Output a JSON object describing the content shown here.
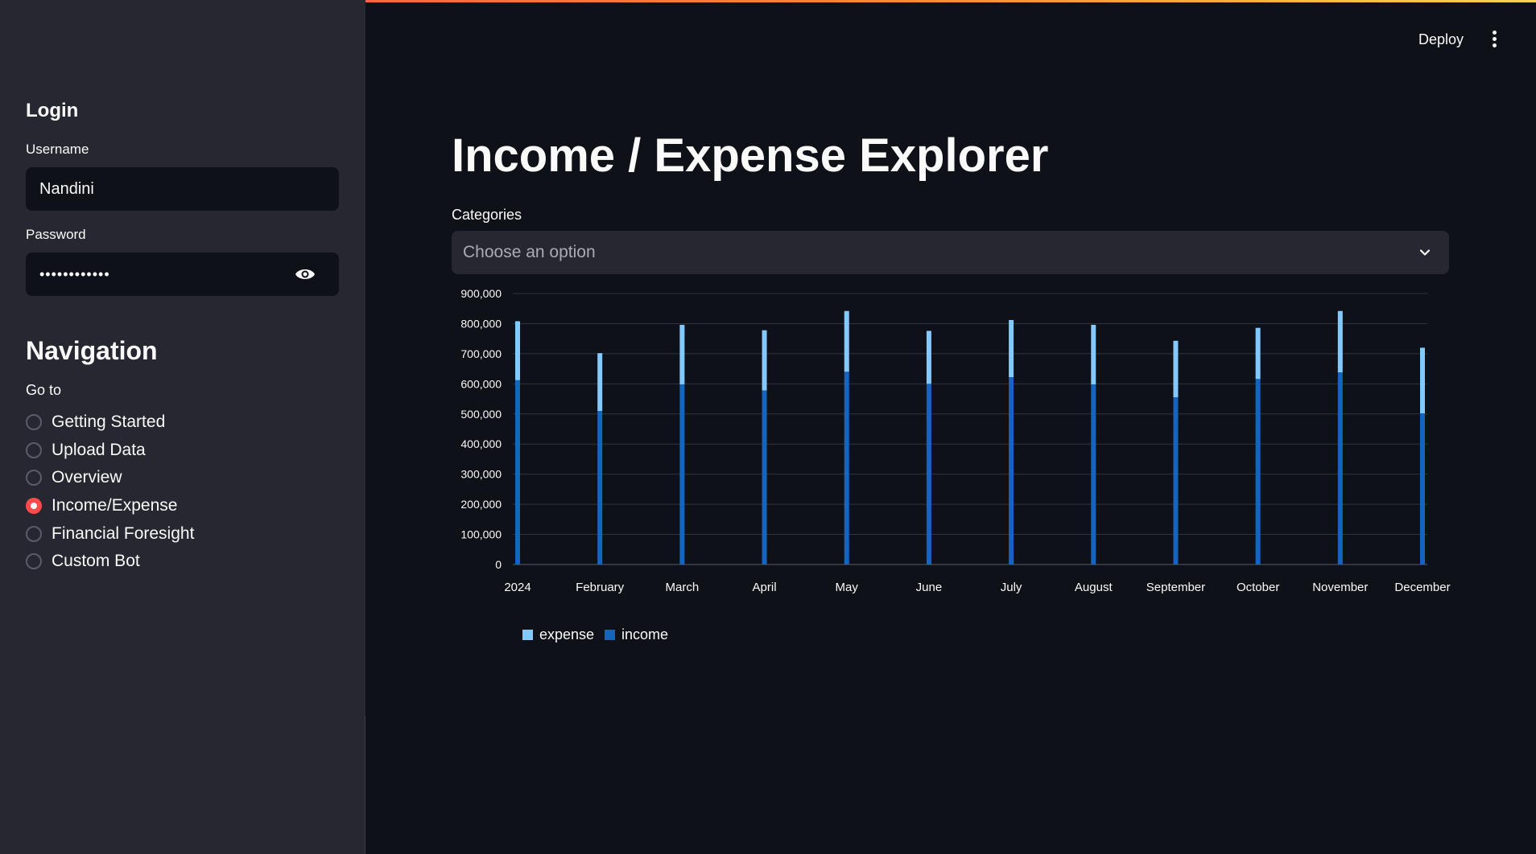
{
  "sidebar": {
    "login_heading": "Login",
    "username_label": "Username",
    "username_value": "Nandini",
    "password_label": "Password",
    "password_value": "••••••••••••",
    "navigation_heading": "Navigation",
    "goto_label": "Go to",
    "nav_items": [
      {
        "label": "Getting Started",
        "selected": false
      },
      {
        "label": "Upload Data",
        "selected": false
      },
      {
        "label": "Overview",
        "selected": false
      },
      {
        "label": "Income/Expense",
        "selected": true
      },
      {
        "label": "Financial Foresight",
        "selected": false
      },
      {
        "label": "Custom Bot",
        "selected": false
      }
    ]
  },
  "header": {
    "deploy_label": "Deploy",
    "menu_icon": "kebab-menu-icon"
  },
  "main": {
    "title": "Income / Expense Explorer",
    "categories_label": "Categories",
    "categories_placeholder": "Choose an option"
  },
  "colors": {
    "accent": "#ff4b4b",
    "income": "#1565c0",
    "expense": "#83c9ff",
    "background": "#0e1117",
    "sidebar": "#262730"
  },
  "chart_data": {
    "type": "bar",
    "stacked": true,
    "categories": [
      "2024",
      "February",
      "March",
      "April",
      "May",
      "June",
      "July",
      "August",
      "September",
      "October",
      "November",
      "December"
    ],
    "series": [
      {
        "name": "income",
        "color": "#1565c0",
        "values": [
          612000,
          510000,
          598000,
          578000,
          640000,
          600000,
          622000,
          598000,
          555000,
          616000,
          638000,
          502000
        ]
      },
      {
        "name": "expense",
        "color": "#83c9ff",
        "values": [
          196000,
          192000,
          198000,
          200000,
          202000,
          176000,
          190000,
          198000,
          188000,
          170000,
          204000,
          218000
        ]
      }
    ],
    "y_ticks": [
      "0",
      "100,000",
      "200,000",
      "300,000",
      "400,000",
      "500,000",
      "600,000",
      "700,000",
      "800,000",
      "900,000"
    ],
    "ylim": [
      0,
      900000
    ],
    "grid": true,
    "legend": [
      "expense",
      "income"
    ],
    "legend_position": "bottom-left"
  }
}
